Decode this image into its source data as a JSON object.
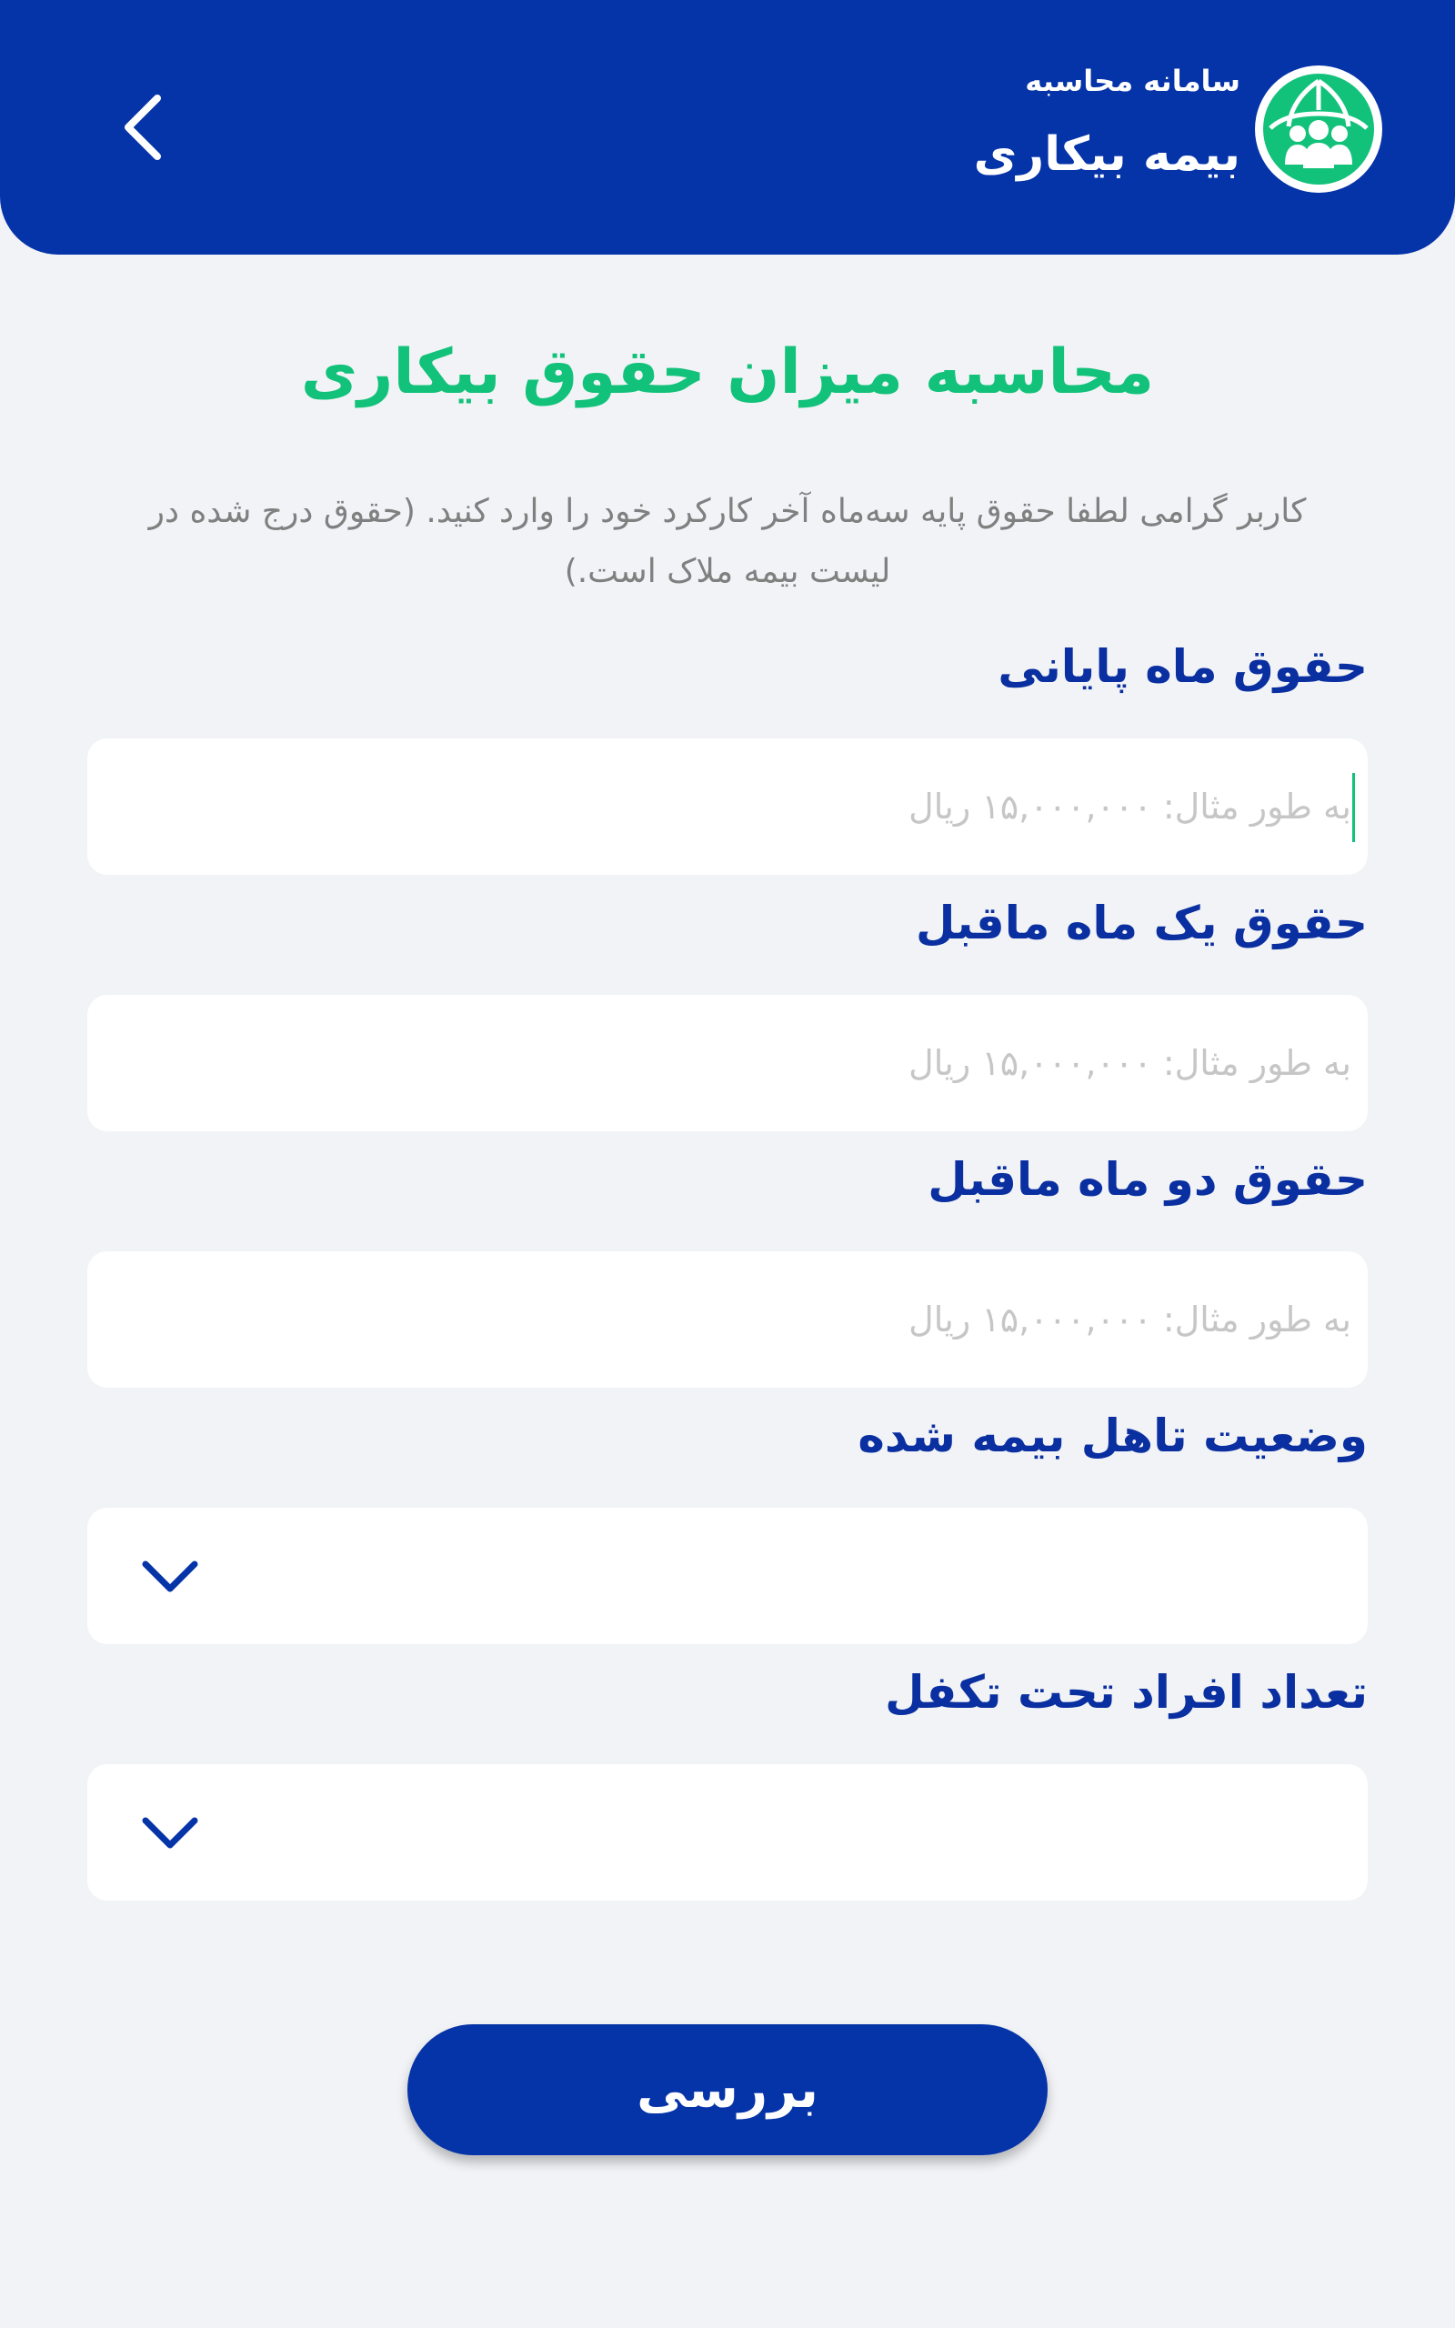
{
  "header": {
    "brand_subtitle": "سامانه محاسبه",
    "brand_title": "بیمه بیکاری",
    "colors": {
      "background": "#0533a8",
      "logo_accent": "#12c27a"
    }
  },
  "page": {
    "title": "محاسبه میزان حقوق بیکاری",
    "description": "کاربر گرامی لطفا حقوق پایه سه‌ماه آخر کارکرد خود را وارد کنید. (حقوق درج شده در لیست بیمه ملاک است.)"
  },
  "form": {
    "fields": [
      {
        "label": "حقوق ماه پایانی",
        "placeholder": "به طور مثال: ۱۵,۰۰۰,۰۰۰ ریال",
        "value": ""
      },
      {
        "label": "حقوق یک ماه ماقبل",
        "placeholder": "به طور مثال: ۱۵,۰۰۰,۰۰۰ ریال",
        "value": ""
      },
      {
        "label": "حقوق دو ماه ماقبل",
        "placeholder": "به طور مثال: ۱۵,۰۰۰,۰۰۰ ریال",
        "value": ""
      }
    ],
    "selects": [
      {
        "label": "وضعیت تاهل بیمه شده",
        "value": ""
      },
      {
        "label": "تعداد افراد تحت تکفل",
        "value": ""
      }
    ],
    "submit_label": "بررسی"
  },
  "icons": {
    "back": "chevron-left-icon",
    "logo": "umbrella-people-icon",
    "dropdown": "chevron-down-icon"
  },
  "colors": {
    "primary": "#0533a8",
    "accent": "#12c27a",
    "label": "#0a2fa0",
    "placeholder": "#c6c6c6",
    "background": "#f2f3f6"
  }
}
